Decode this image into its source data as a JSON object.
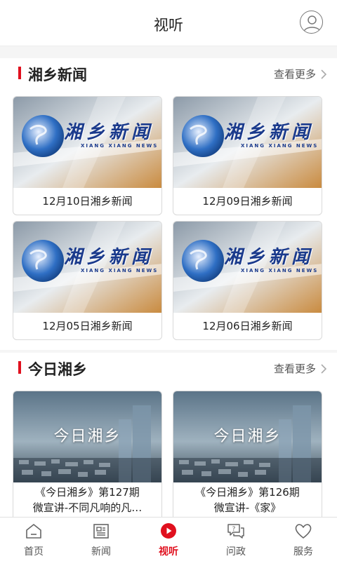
{
  "header": {
    "title": "视听"
  },
  "sections": [
    {
      "title": "湘乡新闻",
      "more": "查看更多",
      "logo_text": "湘乡新闻",
      "logo_sub": "XIANG XIANG NEWS",
      "cards": [
        {
          "caption": "12月10日湘乡新闻"
        },
        {
          "caption": "12月09日湘乡新闻"
        },
        {
          "caption": "12月05日湘乡新闻"
        },
        {
          "caption": "12月06日湘乡新闻"
        }
      ]
    },
    {
      "title": "今日湘乡",
      "more": "查看更多",
      "thumb_text": "今日湘乡",
      "cards": [
        {
          "line1": "《今日湘乡》第127期",
          "line2": "微宣讲-不同凡响的凡…"
        },
        {
          "line1": "《今日湘乡》第126期",
          "line2": "微宣讲-《家》"
        }
      ]
    }
  ],
  "nav": [
    {
      "label": "首页",
      "icon": "home-icon"
    },
    {
      "label": "新闻",
      "icon": "newspaper-icon"
    },
    {
      "label": "视听",
      "icon": "play-icon",
      "active": true
    },
    {
      "label": "问政",
      "icon": "chat-icon"
    },
    {
      "label": "服务",
      "icon": "heart-icon"
    }
  ],
  "colors": {
    "accent": "#e0101e",
    "news_blue": "#1a3a8c"
  }
}
